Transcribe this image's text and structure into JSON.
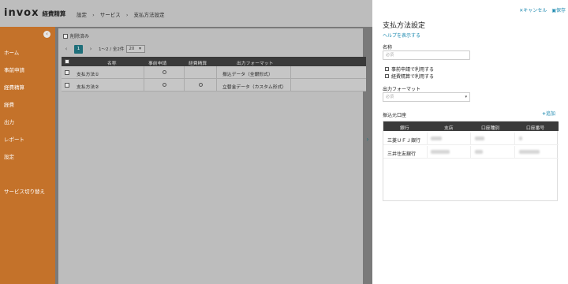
{
  "app": {
    "brand": "invox",
    "product": "経費精算"
  },
  "breadcrumb": [
    "設定",
    "サービス",
    "支払方法設定"
  ],
  "sidebar": {
    "collapse_icon": "‹",
    "items": [
      {
        "label": "ホーム"
      },
      {
        "label": "事前申請"
      },
      {
        "label": "経費精算"
      },
      {
        "label": "経費"
      },
      {
        "label": "出力"
      },
      {
        "label": "レポート"
      },
      {
        "label": "設定"
      },
      {
        "label": "サービス切り替え"
      }
    ]
  },
  "list": {
    "filter_label": "削除済み",
    "pager": {
      "prev": "‹",
      "page": "1",
      "next": "›",
      "range": "1〜2 / 全2件",
      "per_page": "20"
    },
    "columns": [
      "名称",
      "事前申請",
      "経費精算",
      "出力フォーマット"
    ],
    "rows": [
      {
        "name": "支払方法①",
        "pre_application": true,
        "expense": false,
        "format": "振込データ（全銀形式）"
      },
      {
        "name": "支払方法②",
        "pre_application": true,
        "expense": true,
        "format": "立替金データ（カスタム形式）"
      }
    ]
  },
  "panel": {
    "cancel_label": "キャンセル",
    "save_label": "保存",
    "title": "支払方法設定",
    "help_link": "ヘルプを表示する",
    "name_label": "名称",
    "name_placeholder": "必須",
    "checkbox_pre": "事前申請で利用する",
    "checkbox_expense": "経費精算で利用する",
    "format_label": "出力フォーマット",
    "format_placeholder": "必須",
    "accounts_label": "振込元口座",
    "add_label": "追加",
    "account_columns": [
      "銀行",
      "支店",
      "口座種別",
      "口座番号"
    ],
    "accounts": [
      {
        "bank": "三菱ＵＦＪ銀行"
      },
      {
        "bank": "三井住友銀行"
      }
    ]
  },
  "colors": {
    "accent": "#1f8ab0",
    "sidebar": "#c4722a",
    "header_dark": "#3a3a3a",
    "page_active": "#1f6f7a"
  }
}
